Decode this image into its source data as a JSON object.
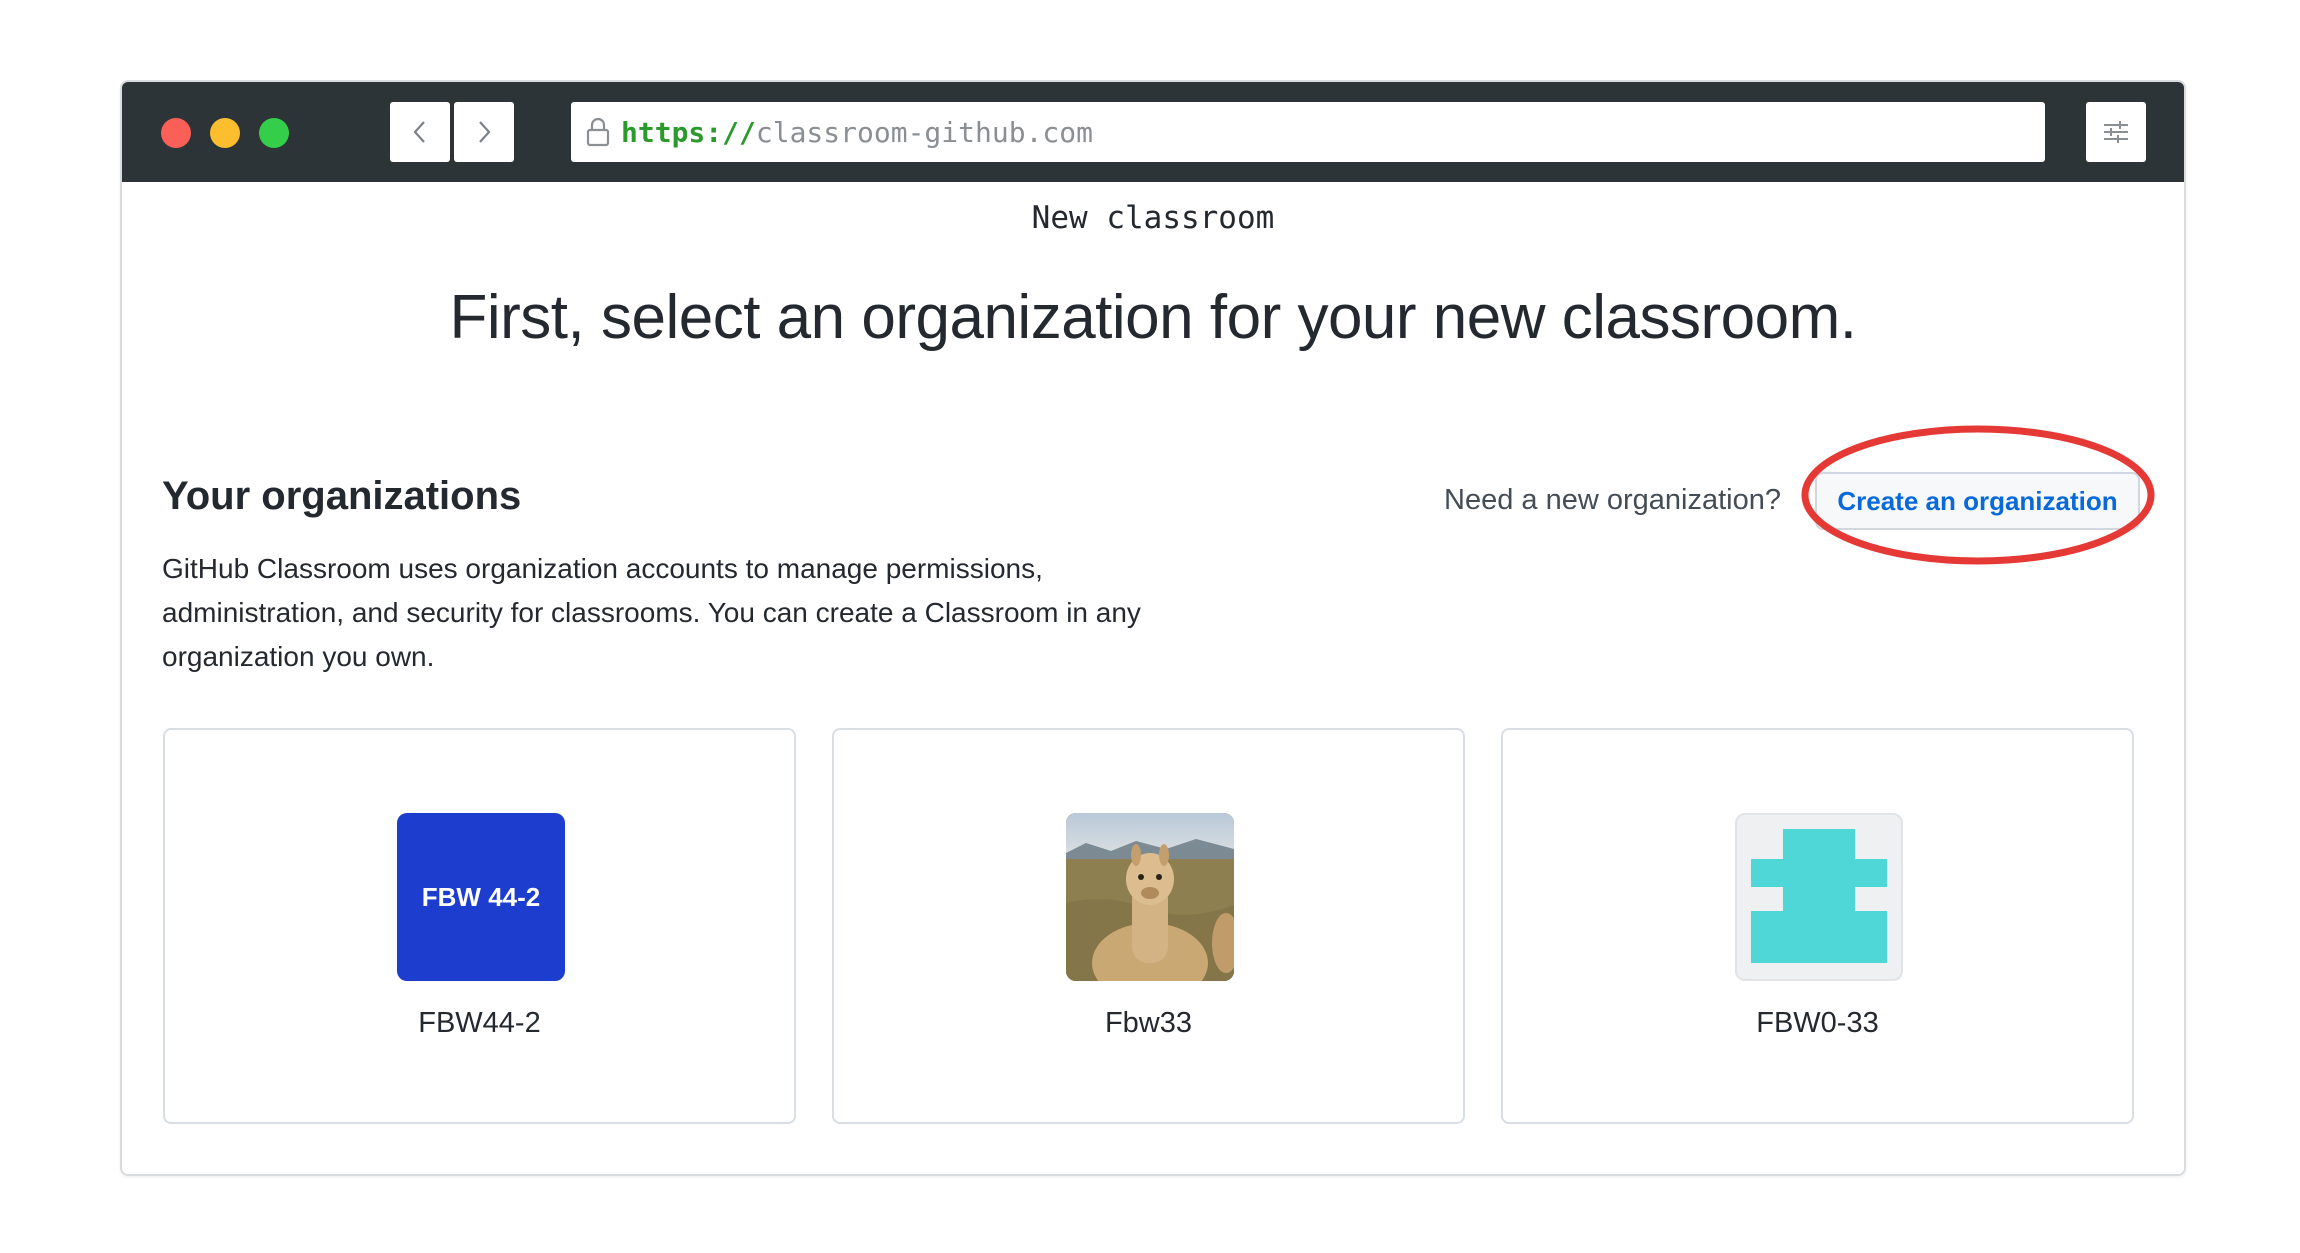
{
  "browser": {
    "url_scheme": "https://",
    "url_host": "classroom-github.com"
  },
  "page": {
    "label": "New classroom",
    "headline": "First, select an organization for your new classroom."
  },
  "organizations_section": {
    "title": "Your organizations",
    "description": "GitHub Classroom uses organization accounts to manage permissions, administration, and security for classrooms. You can create a Classroom in any organization you own.",
    "prompt": "Need a new organization?",
    "create_button": "Create an organization"
  },
  "organizations": [
    {
      "name": "FBW44-2",
      "avatar_text": "FBW 44-2",
      "avatar_color": "#1d3dcf"
    },
    {
      "name": "Fbw33",
      "avatar_type": "photo-alpaca"
    },
    {
      "name": "FBW0-33",
      "avatar_type": "identicon",
      "avatar_color": "#4fd6d6"
    }
  ],
  "colors": {
    "highlight_ring": "#e53935",
    "link_blue": "#0969da",
    "titlebar": "#2c3437"
  }
}
